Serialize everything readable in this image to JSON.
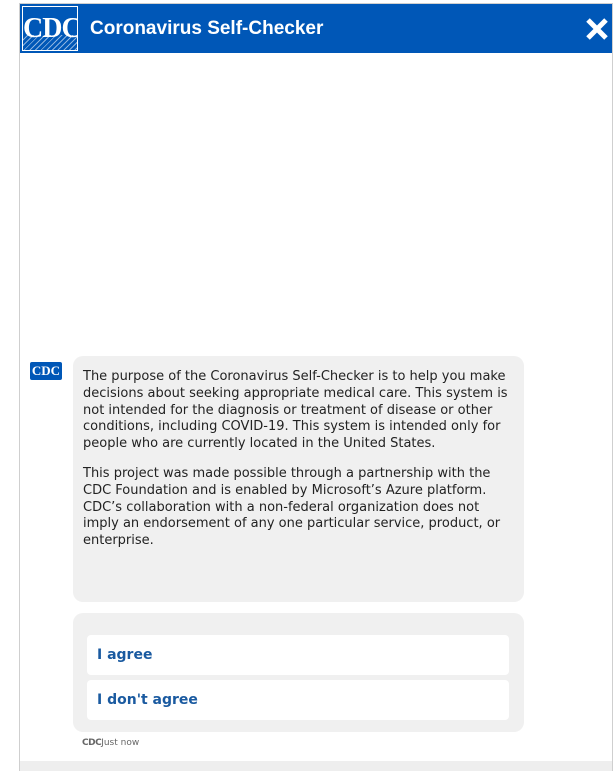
{
  "header": {
    "logo_text": "CDC",
    "title": "Coronavirus Self-Checker",
    "close_icon": "close-icon"
  },
  "colors": {
    "brand": "#0057b7",
    "bubble_bg": "#f0f0f0",
    "choice_text": "#1a5aa0"
  },
  "message": {
    "avatar_text": "CDC",
    "paragraphs": [
      "The purpose of the Coronavirus Self-Checker is to help you make decisions about seeking appropriate medical care. This system is not intended for the diagnosis or treatment of disease or other conditions, including COVID-19. This system is intended only for people who are currently located in the United States.",
      "This project was made possible through a partnership with the CDC Foundation and is enabled by Microsoft’s Azure platform. CDC’s collaboration with a non-federal organization does not imply an endorsement of any one particular service, product, or enterprise."
    ]
  },
  "choices": [
    {
      "label": "I agree"
    },
    {
      "label": "I don't agree"
    }
  ],
  "timestamp": {
    "source": "CDC",
    "time": "Just now"
  }
}
